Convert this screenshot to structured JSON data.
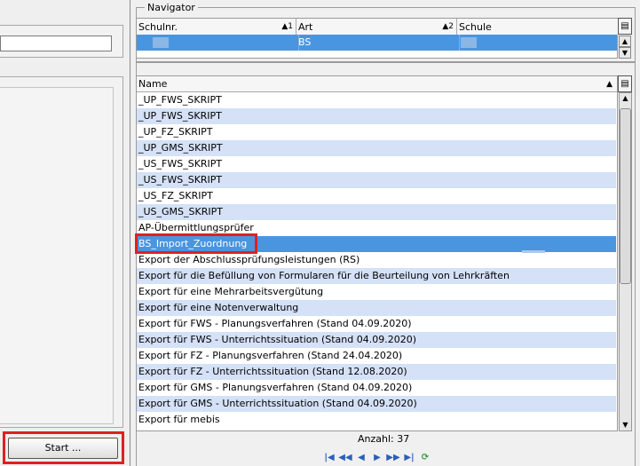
{
  "left": {
    "start_button": "Start ..."
  },
  "navigator": {
    "title": "Navigator",
    "columns": [
      {
        "label": "Schulnr.",
        "sort": "▲1"
      },
      {
        "label": "Art",
        "sort": "▲2"
      },
      {
        "label": "Schule",
        "sort": ""
      }
    ],
    "row": {
      "art": "BS"
    }
  },
  "list": {
    "header": "Name",
    "rows": [
      "_UP_FWS_SKRIPT",
      "_UP_FWS_SKRIPT",
      "_UP_FZ_SKRIPT",
      "_UP_GMS_SKRIPT",
      "_US_FWS_SKRIPT",
      "_US_FWS_SKRIPT",
      "_US_FZ_SKRIPT",
      "_US_GMS_SKRIPT",
      "AP-Übermittlungsprüfer",
      "BS_Import_Zuordnung",
      "Export der Abschlussprüfungsleistungen (RS)",
      "Export für die Befüllung von Formularen für die Beurteilung von Lehrkräften",
      "Export für eine Mehrarbeitsvergütung",
      "Export für eine Notenverwaltung",
      "Export für FWS - Planungsverfahren (Stand 04.09.2020)",
      "Export für FWS - Unterrichtssituation  (Stand 04.09.2020)",
      "Export für FZ - Planungsverfahren (Stand  24.04.2020)",
      "Export für FZ - Unterrichtssituation (Stand  12.08.2020)",
      "Export für GMS - Planungsverfahren  (Stand 04.09.2020)",
      "Export für GMS - Unterrichtssituation (Stand 04.09.2020)",
      "Export für mebis"
    ],
    "selected_row": "BS_Import_Zuordnung",
    "count": "Anzahl: 37"
  },
  "icons": {
    "pager": [
      "first-icon",
      "prev-page-icon",
      "prev-icon",
      "next-icon",
      "next-page-icon",
      "last-icon",
      "refresh-icon"
    ]
  },
  "colors": {
    "selection": "#4a95e0",
    "alt_row": "#d4e1f7",
    "highlight": "#e02020"
  }
}
